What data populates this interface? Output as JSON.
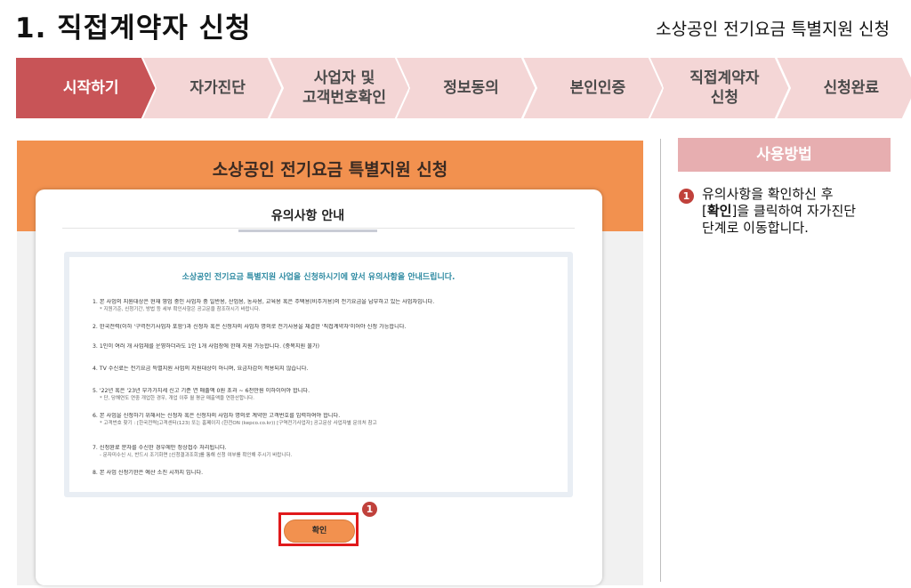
{
  "header": {
    "title": "1. 직접계약자 신청",
    "subtitle": "소상공인 전기요금 특별지원 신청"
  },
  "steps": [
    {
      "label": "시작하기",
      "active": true
    },
    {
      "label": "자가진단",
      "active": false
    },
    {
      "label": "사업자 및\n고객번호확인",
      "active": false
    },
    {
      "label": "정보동의",
      "active": false
    },
    {
      "label": "본인인증",
      "active": false
    },
    {
      "label": "직접계약자\n신청",
      "active": false
    },
    {
      "label": "신청완료",
      "active": false
    }
  ],
  "colors": {
    "step_active": "#c85457",
    "step_inactive": "#f4d6d6",
    "modal_header": "#f2914f",
    "side_header": "#e7aeb0",
    "marker": "#c0413b",
    "highlight": "#e0191b"
  },
  "modal": {
    "title": "소상공인 전기요금 특별지원 신청",
    "tab_label": "유의사항 안내",
    "notice_heading": "소상공인 전기요금 특별지원 사업을 신청하시기에 앞서 유의사항을 안내드립니다.",
    "items": [
      {
        "text": "1. 본 사업의 지원대상은 현재 영업 중인 사업자 중 일반용, 산업용, 농사용, 교육용 혹은 주택용(비주거용)의 전기요금을 납부하고 있는 사업자입니다.",
        "sub": "* 지원기준, 신청기간, 방법 등 세부 확인사항은 공고문을 참조하시기 바랍니다."
      },
      {
        "text": "2. 한국전력(이하 '구역전기사업자 포함')과 신청자 혹은 신청자의 사업자 명의로 전기사용을 체결한 '직접계약자'이어야 신청 가능합니다.",
        "sub": ""
      },
      {
        "text": "3. 1인이 여러 개 사업체를 운영하더라도 1인 1개 사업장에 한해 지원 가능합니다. (중복지원 불가)",
        "sub": ""
      },
      {
        "text": "4. TV 수신료는 전기요금 특별지원 사업의 지원대상이 아니며, 요금차감이 적용되지 않습니다.",
        "sub": ""
      },
      {
        "text": "5. '22년 혹은 '23년 부가가치세 신고 기준 연 매출액 0원 초과 ~ 6천만원 이하이어야 합니다.",
        "sub": "* 단, 당해연도 연중 개업한 경우, 개업 이후 월 평균 매출액을 연환산합니다."
      },
      {
        "text": "6. 본 사업을 신청하기 위해서는 신청자 혹은 신청자의 사업자 명의로 계약한 고객번호를 입력하여야 합니다.",
        "sub": "* 고객번호 찾기 : [한국전력]고객센터(123) 또는 홈페이지 (한전ON (kepco.co.kr))  [구역전기사업자] 공고문상 사업자별 문의처 참고"
      },
      {
        "text": "7. 신청완료 문자를 수신한 경우에만 정상접수 처리됩니다.",
        "sub": "- 문자미수신 시, 반드시 조기화면 [신청결과조회]를 통해 신청 여부를 확인해 주시기 바랍니다."
      },
      {
        "text": "8. 본 사업 신청기한은 예산 소진 시까지 입니다.",
        "sub": ""
      }
    ],
    "confirm_label": "확인",
    "marker_number": "1"
  },
  "side": {
    "header": "사용방법",
    "marker_number": "1",
    "line1": "유의사항을 확인하신 후",
    "bracket_open": "[",
    "bold_word": "확인",
    "line2_rest": "]을 클릭하여 자가진단",
    "line3": "단계로 이동합니다."
  }
}
